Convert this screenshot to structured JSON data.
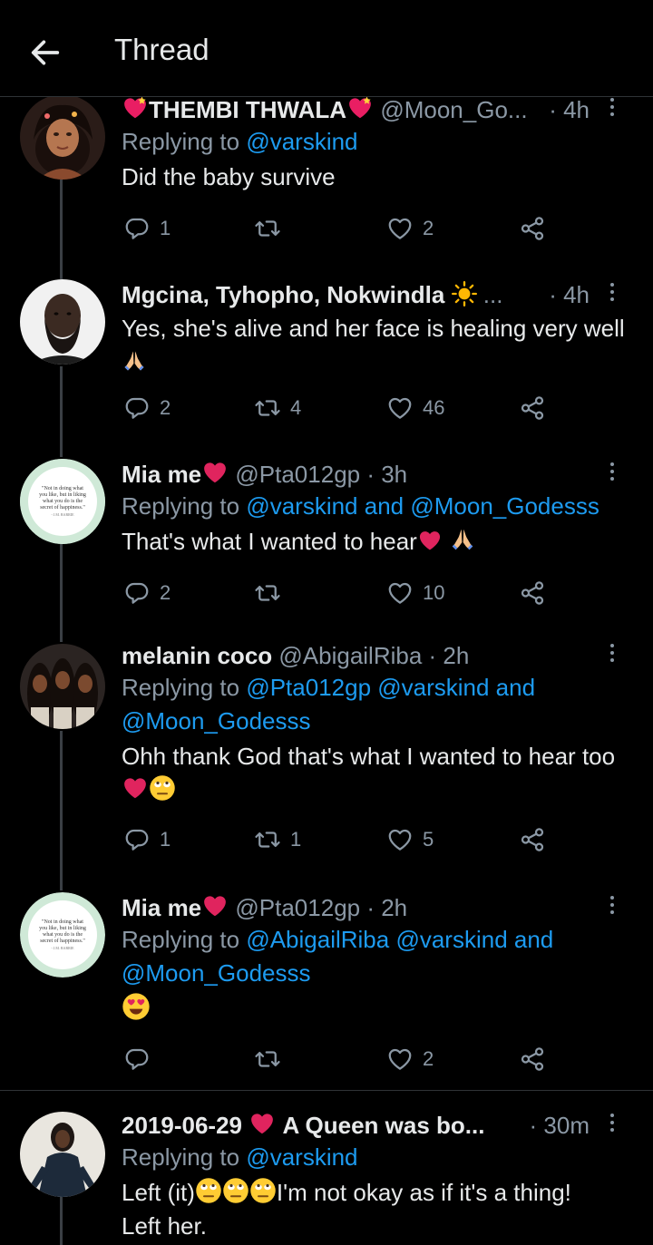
{
  "header": {
    "title": "Thread"
  },
  "tweets": [
    {
      "name": "THEMBI THWALA",
      "handle": "@Moon_Go...",
      "time": "· 4h",
      "replying_prefix": "Replying to ",
      "replying": "@varskind",
      "text": "Did the baby survive",
      "replies": "1",
      "retweets": "",
      "likes": "2"
    },
    {
      "name": "Mgcina, Tyhopho, Nokwindla",
      "handle": "...",
      "time": "· 4h",
      "text": "Yes, she's alive and her face is healing very well",
      "replies": "2",
      "retweets": "4",
      "likes": "46"
    },
    {
      "name": "Mia me",
      "handle": "@Pta012gp",
      "time": "· 3h",
      "replying_prefix": "Replying to ",
      "replying": "@varskind and @Moon_Godesss",
      "text": "That's what I wanted to hear",
      "replies": "2",
      "retweets": "",
      "likes": "10"
    },
    {
      "name": "melanin coco",
      "handle": "@AbigailRiba",
      "time": "· 2h",
      "replying_prefix": "Replying to ",
      "replying": "@Pta012gp @varskind and @Moon_Godesss",
      "text": "Ohh thank God that's what I wanted to hear too",
      "replies": "1",
      "retweets": "1",
      "likes": "5"
    },
    {
      "name": "Mia me",
      "handle": "@Pta012gp",
      "time": "· 2h",
      "replying_prefix": "Replying to ",
      "replying": "@AbigailRiba @varskind and @Moon_Godesss",
      "text": "",
      "replies": "",
      "retweets": "",
      "likes": "2"
    },
    {
      "name_a": "2019-06-29",
      "name_b": "A Queen was bo...",
      "time": "· 30m",
      "replying_prefix": "Replying to ",
      "replying": "@varskind",
      "text_a": "Left (it)",
      "text_b": "I'm not okay as if it's a thing!",
      "text_c": "Left her."
    }
  ],
  "avatar_quote": "\"Not in doing what you like, but in liking what you do is the secret of happiness.\"",
  "avatar_quote_author": "- J.M. BARRIE",
  "colors": {
    "link": "#1d9bf0",
    "muted": "#8b98a5",
    "background": "#000000"
  }
}
